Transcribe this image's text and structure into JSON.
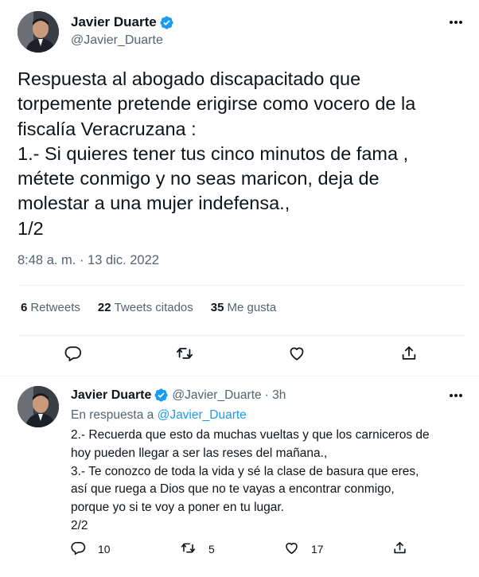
{
  "main_tweet": {
    "author_name": "Javier Duarte",
    "author_handle": "@Javier_Duarte",
    "text": "Respuesta al abogado discapacitado que\ntorpemente pretende erigirse como vocero de la\nfiscalía Veracruzana :\n1.- Si quieres tener tus cinco minutos de fama ,\nmétete conmigo y no seas maricon, deja de\nmolestar a una mujer indefensa.,\n1/2",
    "timestamp": "8:48 a. m. · 13 dic. 2022",
    "stats": {
      "retweets_count": "6",
      "retweets_label": "Retweets",
      "quotes_count": "22",
      "quotes_label": "Tweets citados",
      "likes_count": "35",
      "likes_label": "Me gusta"
    }
  },
  "reply_tweet": {
    "author_name": "Javier Duarte",
    "author_handle": "@Javier_Duarte",
    "time_ago": "· 3h",
    "reply_prefix": "En respuesta a ",
    "reply_mention": "@Javier_Duarte",
    "text": "2.- Recuerda que esto da muchas vueltas y que los carniceros de\nhoy pueden llegar a ser las reses del mañana.,\n3.- Te conozco de toda la vida y sé la clase de basura que eres,\nasí que ruega a Dios que no te vayas a encontrar conmigo,\nporque yo si te voy a poner en tu lugar.\n2/2",
    "actions": {
      "replies": "10",
      "retweets": "5",
      "likes": "17"
    }
  },
  "colors": {
    "accent": "#1d9bf0",
    "muted": "#536471",
    "text": "#0f1419",
    "divider": "#eff3f4"
  },
  "icons": [
    "verified-badge-icon",
    "more-icon",
    "reply-icon",
    "retweet-icon",
    "like-icon",
    "share-icon"
  ]
}
